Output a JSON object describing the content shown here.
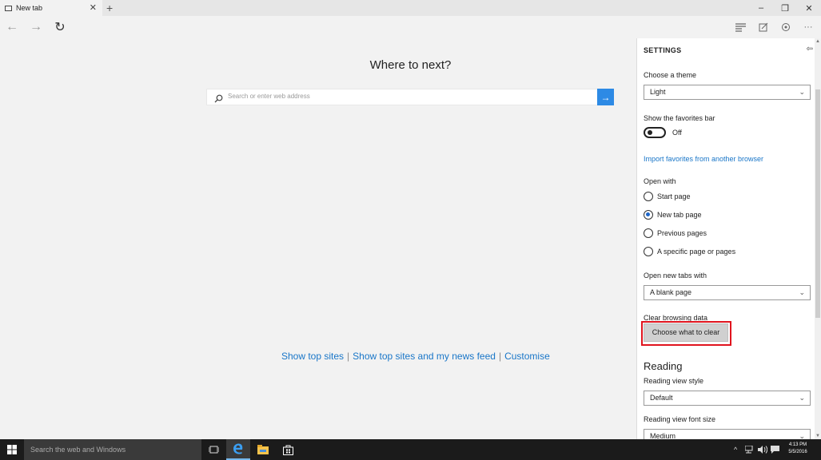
{
  "browser": {
    "tab_title": "New tab",
    "tab_close": "✕",
    "new_tab": "+",
    "window": {
      "minimize": "–",
      "restore": "❐",
      "close": "✕"
    },
    "nav": {
      "back": "←",
      "forward": "→",
      "refresh": "↻"
    },
    "toolbar": {
      "more": "···"
    }
  },
  "new_tab_page": {
    "headline": "Where to next?",
    "search_placeholder": "Search or enter web address",
    "go_arrow": "→",
    "links": [
      "Show top sites",
      "Show top sites and my news feed",
      "Customise"
    ],
    "separator": "|"
  },
  "settings": {
    "header": "SETTINGS",
    "pin": "⇦",
    "theme_label": "Choose a theme",
    "theme_value": "Light",
    "favorites_bar_label": "Show the favorites bar",
    "favorites_bar_state": "Off",
    "favorites_bar_on": false,
    "import_link": "Import favorites from another browser",
    "open_with_label": "Open with",
    "open_with_options": [
      {
        "label": "Start page",
        "selected": false
      },
      {
        "label": "New tab page",
        "selected": true
      },
      {
        "label": "Previous pages",
        "selected": false
      },
      {
        "label": "A specific page or pages",
        "selected": false
      }
    ],
    "new_tabs_label": "Open new tabs with",
    "new_tabs_value": "A blank page",
    "clear_label": "Clear browsing data",
    "clear_button": "Choose what to clear",
    "reading_heading": "Reading",
    "reading_style_label": "Reading view style",
    "reading_style_value": "Default",
    "reading_font_label": "Reading view font size",
    "reading_font_value": "Medium",
    "chevron": "⌄"
  },
  "taskbar": {
    "search_placeholder": "Search the web and Windows",
    "time": "4:13 PM",
    "date": "5/5/2016",
    "tray_chevron": "^"
  },
  "colors": {
    "accent": "#2d8ae5",
    "link": "#1976c8",
    "highlight": "#e0141e"
  }
}
